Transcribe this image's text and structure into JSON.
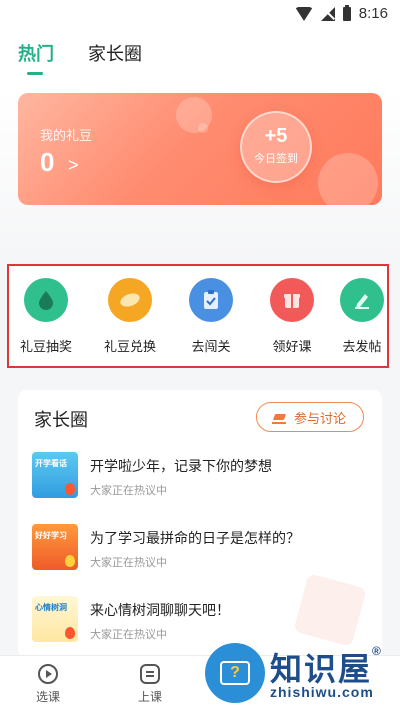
{
  "status_bar": {
    "time": "8:16"
  },
  "tabs": [
    {
      "label": "热门",
      "active": true
    },
    {
      "label": "家长圈",
      "active": false
    }
  ],
  "beans_card": {
    "label": "我的礼豆",
    "value": "0",
    "arrow": ">",
    "signin_value": "+5",
    "signin_label": "今日签到"
  },
  "quick_actions": [
    {
      "label": "礼豆抽奖",
      "icon": "drop-icon",
      "color": "#2fc08e"
    },
    {
      "label": "礼豆兑换",
      "icon": "bean-icon",
      "color": "#f5a623"
    },
    {
      "label": "去闯关",
      "icon": "clipboard-icon",
      "color": "#4a90e2"
    },
    {
      "label": "领好课",
      "icon": "gift-icon",
      "color": "#f25a5a"
    },
    {
      "label": "去发帖",
      "icon": "pen-icon",
      "color": "#2fc08e"
    }
  ],
  "forum": {
    "title": "家长圈",
    "join_label": "参与讨论",
    "posts": [
      {
        "title": "开学啦少年，记录下你的梦想",
        "subtitle": "大家正在热议中",
        "thumb_text": "开学看话"
      },
      {
        "title": "为了学习最拼命的日子是怎样的？",
        "subtitle": "大家正在热议中",
        "thumb_text": "好好学习"
      },
      {
        "title": "来心情树洞聊聊天吧！",
        "subtitle": "大家正在热议中",
        "thumb_text": "心情树洞"
      }
    ]
  },
  "bottom_nav": [
    {
      "label": "选课",
      "icon": "play-circle-icon"
    },
    {
      "label": "上课",
      "icon": "lesson-icon"
    }
  ],
  "watermark": {
    "text": "知识屋",
    "mark": "®",
    "domain": "zhishiwu.com",
    "glyph": "?"
  }
}
